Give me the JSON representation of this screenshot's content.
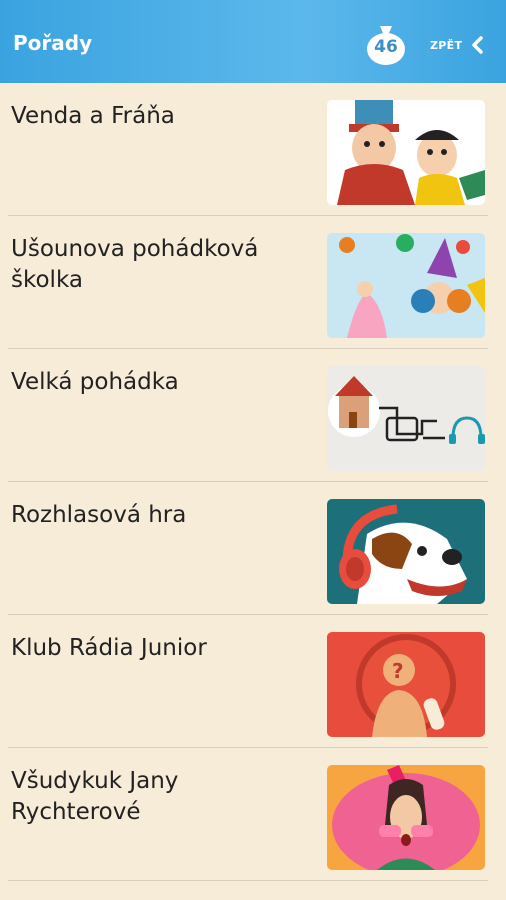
{
  "header": {
    "title": "Pořady",
    "badge_count": "46",
    "back_label": "ZPĚT"
  },
  "shows": [
    {
      "label": "Venda a Fráňa",
      "icon": "cartoon-duo-thumbnail"
    },
    {
      "label": "Ušounova pohádková školka",
      "icon": "fairy-tale-characters-thumbnail"
    },
    {
      "label": "Velká pohádka",
      "icon": "castle-headphones-thumbnail"
    },
    {
      "label": "Rozhlasová hra",
      "icon": "dog-headphones-thumbnail"
    },
    {
      "label": "Klub Rádia Junior",
      "icon": "silhouette-question-thumbnail"
    },
    {
      "label": "Všudykuk Jany Rychterové",
      "icon": "woman-glasses-thumbnail"
    }
  ],
  "colors": {
    "header": "#3aa3df",
    "background": "#f6ecd8",
    "text": "#222222"
  }
}
